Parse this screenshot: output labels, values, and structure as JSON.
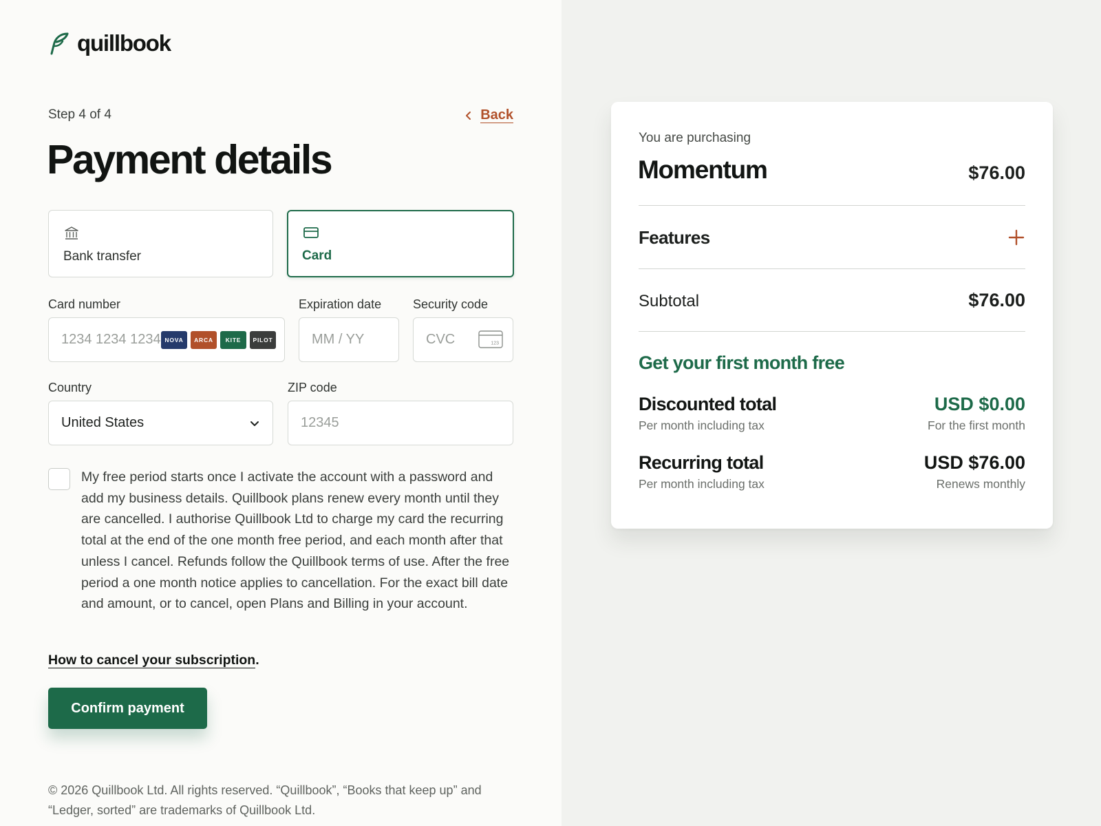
{
  "brand": {
    "name": "quillbook",
    "accent": "#1d6a49",
    "link_color": "#b1502a"
  },
  "header": {
    "step": "Step 4 of 4",
    "back_label": "Back",
    "title": "Payment details"
  },
  "methods": [
    {
      "label": "Bank transfer",
      "icon": "bank-icon",
      "selected": false
    },
    {
      "label": "Card",
      "icon": "credit-card-icon",
      "selected": true
    }
  ],
  "form": {
    "card_number": {
      "label": "Card number",
      "placeholder": "1234 1234 1234",
      "brands": [
        "NOVA",
        "ARCA",
        "KITE",
        "PILOT"
      ]
    },
    "expiry": {
      "label": "Expiration date",
      "placeholder": "MM / YY"
    },
    "security": {
      "label": "Security code",
      "placeholder": "CVC",
      "icon_text": "123"
    },
    "country": {
      "label": "Country",
      "value": "United States"
    },
    "zip": {
      "label": "ZIP code",
      "placeholder": "12345"
    }
  },
  "consent": {
    "checked": false,
    "text": "My free period starts once I activate the account with a password and add my business details. Quillbook plans renew every month until they are cancelled. I authorise Quillbook Ltd to charge my card the recurring total at the end of the one month free period, and each month after that unless I cancel. Refunds follow the Quillbook terms of use. After the free period a one month notice applies to cancellation. For the exact bill date and amount, or to cancel, open Plans and Billing in your account."
  },
  "cancel_link": {
    "label": "How to cancel your subscription",
    "suffix": "."
  },
  "confirm_label": "Confirm payment",
  "footer": "© 2026 Quillbook Ltd. All rights reserved. “Quillbook”, “Books that keep up” and “Ledger, sorted” are trademarks of Quillbook Ltd.",
  "summary": {
    "purchasing_label": "You are purchasing",
    "plan": "Momentum",
    "plan_price": "$76.00",
    "features_label": "Features",
    "subtotal_label": "Subtotal",
    "subtotal_value": "$76.00",
    "promo": "Get your first month free",
    "discounted": {
      "label": "Discounted total",
      "note": "Per month including tax",
      "value": "USD $0.00",
      "value_note": "For the first month"
    },
    "recurring": {
      "label": "Recurring total",
      "note": "Per month including tax",
      "value": "USD $76.00",
      "value_note": "Renews monthly"
    }
  }
}
